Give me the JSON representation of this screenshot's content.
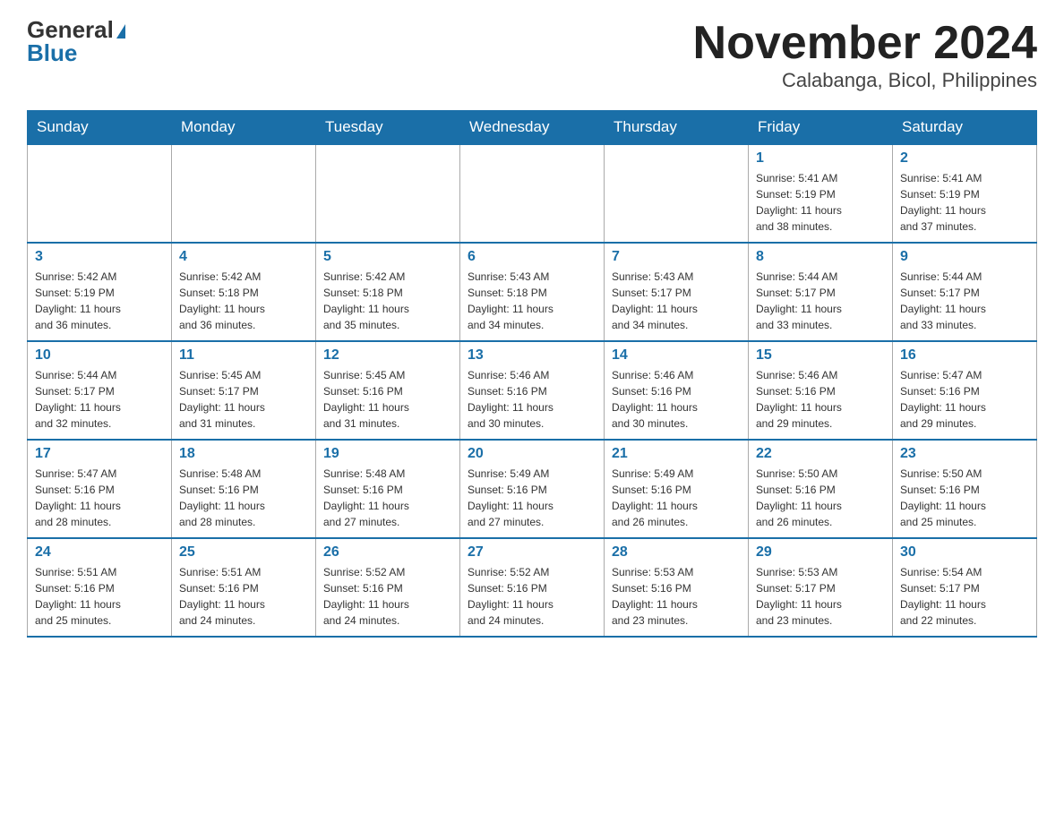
{
  "logo": {
    "general": "General",
    "blue": "Blue"
  },
  "header": {
    "title": "November 2024",
    "subtitle": "Calabanga, Bicol, Philippines"
  },
  "weekdays": [
    "Sunday",
    "Monday",
    "Tuesday",
    "Wednesday",
    "Thursday",
    "Friday",
    "Saturday"
  ],
  "weeks": [
    [
      {
        "day": "",
        "info": ""
      },
      {
        "day": "",
        "info": ""
      },
      {
        "day": "",
        "info": ""
      },
      {
        "day": "",
        "info": ""
      },
      {
        "day": "",
        "info": ""
      },
      {
        "day": "1",
        "info": "Sunrise: 5:41 AM\nSunset: 5:19 PM\nDaylight: 11 hours\nand 38 minutes."
      },
      {
        "day": "2",
        "info": "Sunrise: 5:41 AM\nSunset: 5:19 PM\nDaylight: 11 hours\nand 37 minutes."
      }
    ],
    [
      {
        "day": "3",
        "info": "Sunrise: 5:42 AM\nSunset: 5:19 PM\nDaylight: 11 hours\nand 36 minutes."
      },
      {
        "day": "4",
        "info": "Sunrise: 5:42 AM\nSunset: 5:18 PM\nDaylight: 11 hours\nand 36 minutes."
      },
      {
        "day": "5",
        "info": "Sunrise: 5:42 AM\nSunset: 5:18 PM\nDaylight: 11 hours\nand 35 minutes."
      },
      {
        "day": "6",
        "info": "Sunrise: 5:43 AM\nSunset: 5:18 PM\nDaylight: 11 hours\nand 34 minutes."
      },
      {
        "day": "7",
        "info": "Sunrise: 5:43 AM\nSunset: 5:17 PM\nDaylight: 11 hours\nand 34 minutes."
      },
      {
        "day": "8",
        "info": "Sunrise: 5:44 AM\nSunset: 5:17 PM\nDaylight: 11 hours\nand 33 minutes."
      },
      {
        "day": "9",
        "info": "Sunrise: 5:44 AM\nSunset: 5:17 PM\nDaylight: 11 hours\nand 33 minutes."
      }
    ],
    [
      {
        "day": "10",
        "info": "Sunrise: 5:44 AM\nSunset: 5:17 PM\nDaylight: 11 hours\nand 32 minutes."
      },
      {
        "day": "11",
        "info": "Sunrise: 5:45 AM\nSunset: 5:17 PM\nDaylight: 11 hours\nand 31 minutes."
      },
      {
        "day": "12",
        "info": "Sunrise: 5:45 AM\nSunset: 5:16 PM\nDaylight: 11 hours\nand 31 minutes."
      },
      {
        "day": "13",
        "info": "Sunrise: 5:46 AM\nSunset: 5:16 PM\nDaylight: 11 hours\nand 30 minutes."
      },
      {
        "day": "14",
        "info": "Sunrise: 5:46 AM\nSunset: 5:16 PM\nDaylight: 11 hours\nand 30 minutes."
      },
      {
        "day": "15",
        "info": "Sunrise: 5:46 AM\nSunset: 5:16 PM\nDaylight: 11 hours\nand 29 minutes."
      },
      {
        "day": "16",
        "info": "Sunrise: 5:47 AM\nSunset: 5:16 PM\nDaylight: 11 hours\nand 29 minutes."
      }
    ],
    [
      {
        "day": "17",
        "info": "Sunrise: 5:47 AM\nSunset: 5:16 PM\nDaylight: 11 hours\nand 28 minutes."
      },
      {
        "day": "18",
        "info": "Sunrise: 5:48 AM\nSunset: 5:16 PM\nDaylight: 11 hours\nand 28 minutes."
      },
      {
        "day": "19",
        "info": "Sunrise: 5:48 AM\nSunset: 5:16 PM\nDaylight: 11 hours\nand 27 minutes."
      },
      {
        "day": "20",
        "info": "Sunrise: 5:49 AM\nSunset: 5:16 PM\nDaylight: 11 hours\nand 27 minutes."
      },
      {
        "day": "21",
        "info": "Sunrise: 5:49 AM\nSunset: 5:16 PM\nDaylight: 11 hours\nand 26 minutes."
      },
      {
        "day": "22",
        "info": "Sunrise: 5:50 AM\nSunset: 5:16 PM\nDaylight: 11 hours\nand 26 minutes."
      },
      {
        "day": "23",
        "info": "Sunrise: 5:50 AM\nSunset: 5:16 PM\nDaylight: 11 hours\nand 25 minutes."
      }
    ],
    [
      {
        "day": "24",
        "info": "Sunrise: 5:51 AM\nSunset: 5:16 PM\nDaylight: 11 hours\nand 25 minutes."
      },
      {
        "day": "25",
        "info": "Sunrise: 5:51 AM\nSunset: 5:16 PM\nDaylight: 11 hours\nand 24 minutes."
      },
      {
        "day": "26",
        "info": "Sunrise: 5:52 AM\nSunset: 5:16 PM\nDaylight: 11 hours\nand 24 minutes."
      },
      {
        "day": "27",
        "info": "Sunrise: 5:52 AM\nSunset: 5:16 PM\nDaylight: 11 hours\nand 24 minutes."
      },
      {
        "day": "28",
        "info": "Sunrise: 5:53 AM\nSunset: 5:16 PM\nDaylight: 11 hours\nand 23 minutes."
      },
      {
        "day": "29",
        "info": "Sunrise: 5:53 AM\nSunset: 5:17 PM\nDaylight: 11 hours\nand 23 minutes."
      },
      {
        "day": "30",
        "info": "Sunrise: 5:54 AM\nSunset: 5:17 PM\nDaylight: 11 hours\nand 22 minutes."
      }
    ]
  ]
}
